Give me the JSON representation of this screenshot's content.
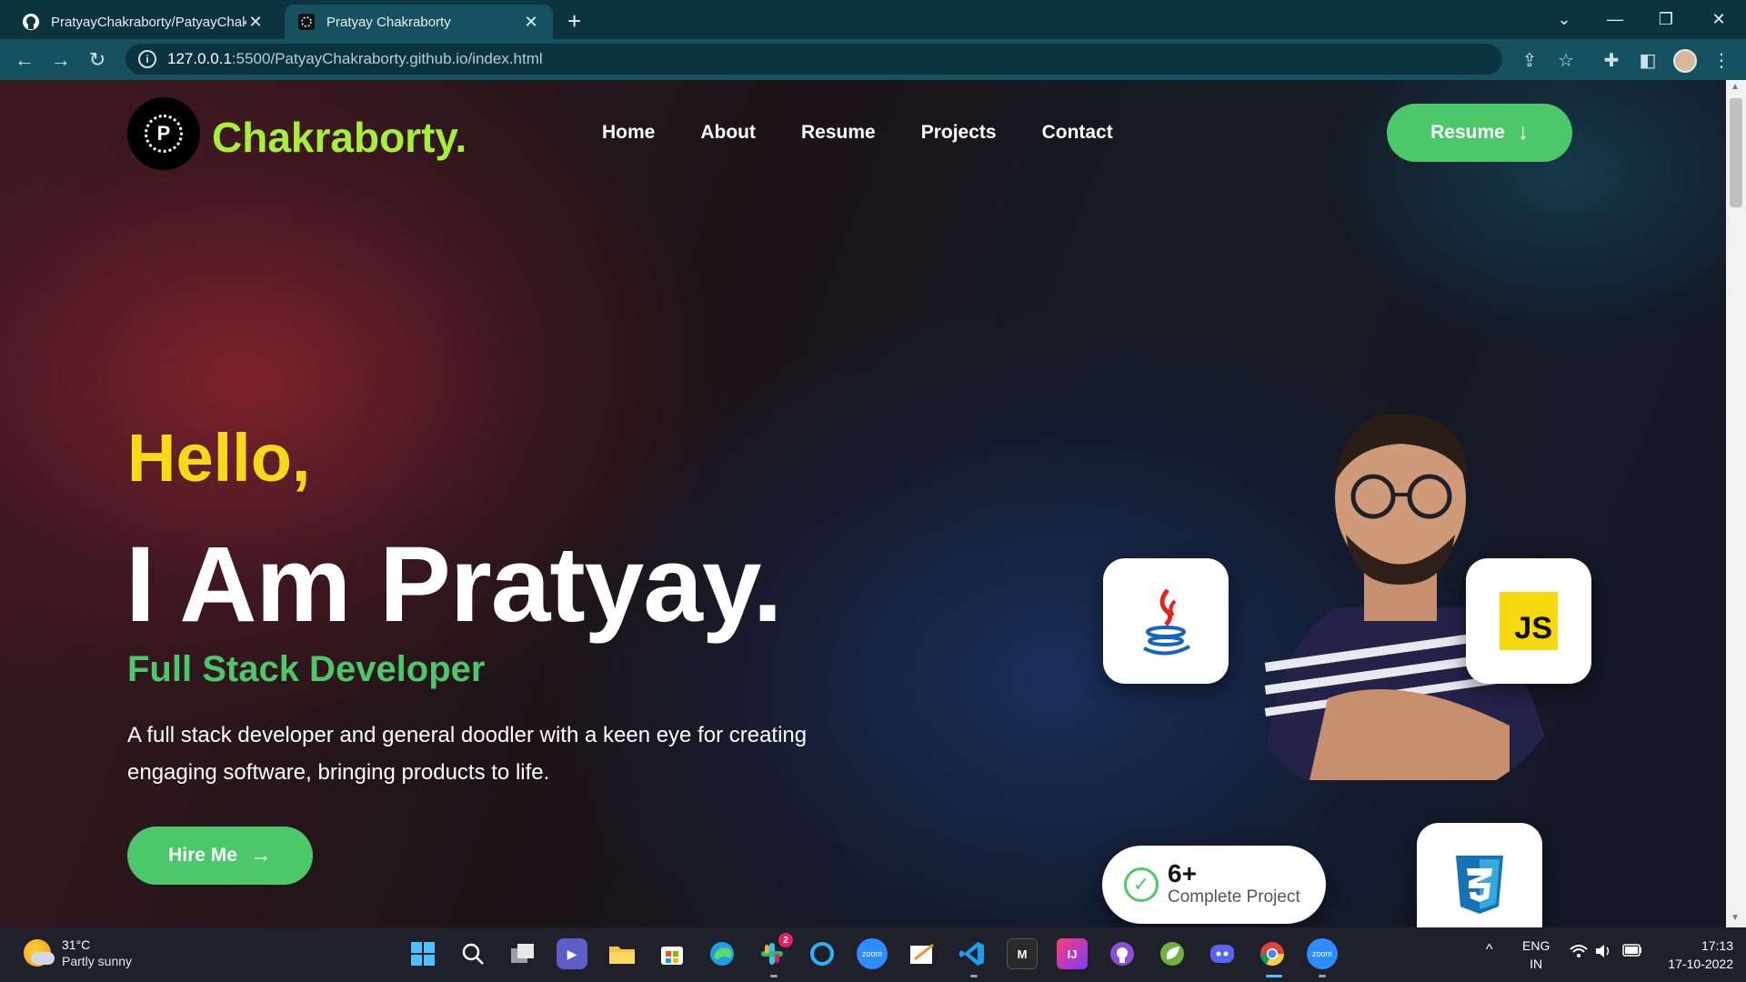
{
  "browser": {
    "tabs": [
      {
        "title": "PratyayChakraborty/PatyayChakr",
        "icon": "github-icon",
        "active": false
      },
      {
        "title": "Pratyay Chakraborty",
        "icon": "site-favicon",
        "active": true
      }
    ],
    "new_tab": "+",
    "window_controls": {
      "tab_search": "⌄",
      "minimize": "—",
      "restore": "❐",
      "close": "✕"
    },
    "address": {
      "host": "127.0.0.1",
      "path": ":5500/PatyayChakraborty.github.io/index.html"
    },
    "toolbar_icons": [
      "share-icon",
      "star-icon",
      "extensions-icon",
      "sidebar-icon",
      "profile-avatar",
      "menu-icon"
    ]
  },
  "site": {
    "logo_letter": "P",
    "brand": "Chakraborty.",
    "nav": [
      "Home",
      "About",
      "Resume",
      "Projects",
      "Contact"
    ],
    "resume_button": "Resume",
    "hero": {
      "greeting": "Hello,",
      "headline": "I Am Pratyay.",
      "role": "Full Stack Developer",
      "description": "A full stack developer and general doodler with a keen eye for creating engaging software, bringing products to life.",
      "cta": "Hire Me"
    },
    "stats": {
      "count": "6+",
      "label": "Complete Project"
    },
    "skill_cards": [
      "java-icon",
      "javascript-icon",
      "css3-icon"
    ],
    "js_badge": "JS",
    "colors": {
      "brand": "#a6f03a",
      "greeting": "#f5da18",
      "accent": "#4cc86a"
    }
  },
  "taskbar": {
    "weather": {
      "temp": "31°C",
      "condition": "Partly sunny"
    },
    "apps": [
      "windows-start-icon",
      "search-icon",
      "task-view-icon",
      "teams-chat-icon",
      "file-explorer-icon",
      "microsoft-store-icon",
      "edge-icon",
      "slack-icon",
      "cortana-icon",
      "zoom-icon",
      "whiteboard-icon",
      "vscode-icon",
      "markdown-app-icon",
      "intellij-icon",
      "github-desktop-icon",
      "spring-icon",
      "discord-icon",
      "chrome-icon",
      "zoom-icon"
    ],
    "slack_badge": "2",
    "zoom_label": "zoom",
    "markdown_label": "M",
    "intellij_label": "IJ",
    "tray": {
      "chevron": "^",
      "lang": "ENG",
      "region": "IN"
    },
    "time": "17:13",
    "date": "17-10-2022"
  }
}
